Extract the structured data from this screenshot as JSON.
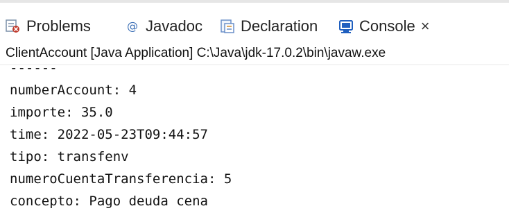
{
  "tabs": [
    {
      "label": "Problems",
      "icon": "problems-icon"
    },
    {
      "label": "Javadoc",
      "icon": "javadoc-icon"
    },
    {
      "label": "Declaration",
      "icon": "declaration-icon"
    },
    {
      "label": "Console",
      "icon": "console-icon",
      "active": true,
      "close": "×"
    }
  ],
  "launch_info": "ClientAccount [Java Application] C:\\Java\\jdk-17.0.2\\bin\\javaw.exe",
  "console_lines": [
    "------",
    "numberAccount: 4",
    "importe: 35.0",
    "time: 2022-05-23T09:44:57",
    "tipo: transfenv",
    "numeroCuentaTransferencia: 5",
    "concepto: Pago deuda cena"
  ],
  "colors": {
    "problems_icon": "#c0392b",
    "javadoc_icon": "#3b6fb6",
    "declaration_icon": "#6a8fc8",
    "console_icon": "#1f5fbf"
  }
}
